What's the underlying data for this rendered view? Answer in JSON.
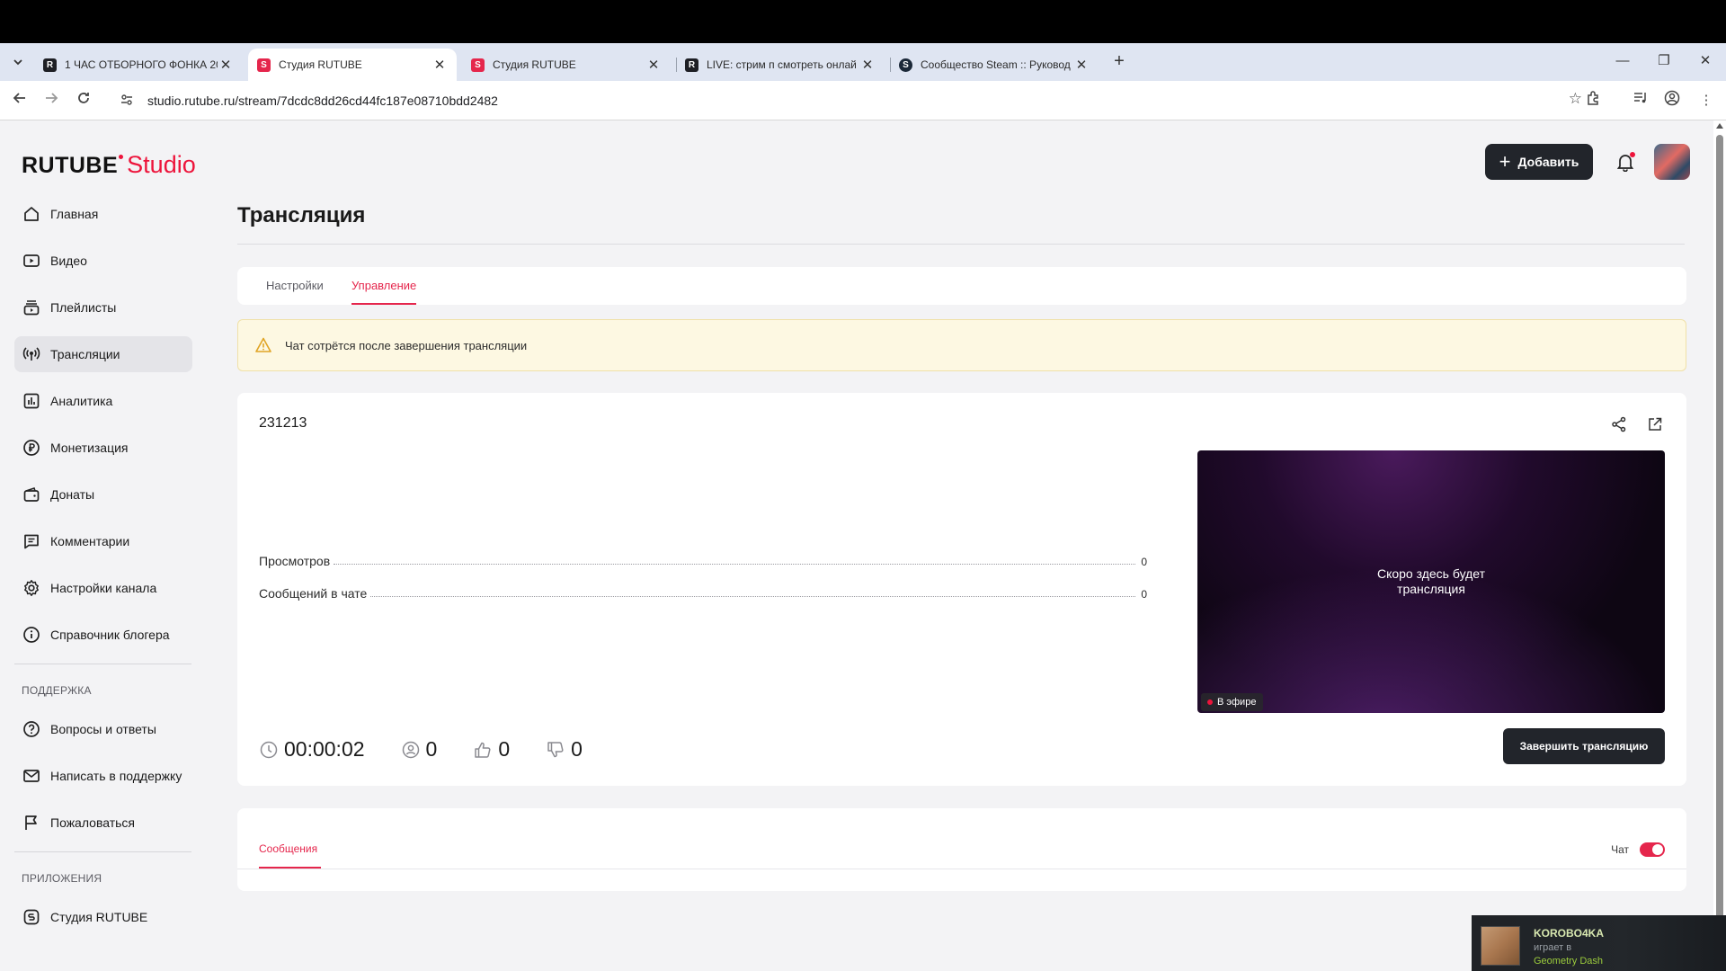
{
  "browser": {
    "tabs": [
      {
        "title": "1 ЧАС ОТБОРНОГО ФОНКА 20",
        "favicon": "rutube-logo",
        "color": "#1e1f25",
        "active": false
      },
      {
        "title": "Студия RUTUBE",
        "favicon": "rutube-studio-logo",
        "color": "#e5264c",
        "active": true
      },
      {
        "title": "Студия RUTUBE",
        "favicon": "rutube-studio-logo",
        "color": "#e5264c",
        "active": false
      },
      {
        "title": "LIVE: стрим п смотреть онлай",
        "favicon": "rutube-logo",
        "color": "#1e1f25",
        "active": false
      },
      {
        "title": "Сообщество Steam :: Руковод",
        "favicon": "steam-logo",
        "color": "#1b2838",
        "active": false
      }
    ],
    "url": "studio.rutube.ru/stream/7dcdc8dd26cd44fc187e08710bdd2482"
  },
  "logo": {
    "brand": "RUTUBE",
    "product": "Studio"
  },
  "header": {
    "add_label": "Добавить"
  },
  "sidebar": {
    "items": [
      {
        "label": "Главная",
        "icon": "home-icon"
      },
      {
        "label": "Видео",
        "icon": "video-icon"
      },
      {
        "label": "Плейлисты",
        "icon": "playlist-icon"
      },
      {
        "label": "Трансляции",
        "icon": "broadcast-icon",
        "active": true
      },
      {
        "label": "Аналитика",
        "icon": "analytics-icon"
      },
      {
        "label": "Монетизация",
        "icon": "ruble-icon"
      },
      {
        "label": "Донаты",
        "icon": "wallet-icon"
      },
      {
        "label": "Комментарии",
        "icon": "comment-icon"
      },
      {
        "label": "Настройки канала",
        "icon": "gear-icon"
      },
      {
        "label": "Справочник блогера",
        "icon": "info-icon"
      }
    ],
    "support_title": "ПОДДЕРЖКА",
    "support_items": [
      {
        "label": "Вопросы и ответы",
        "icon": "question-icon"
      },
      {
        "label": "Написать в поддержку",
        "icon": "mail-icon"
      },
      {
        "label": "Пожаловаться",
        "icon": "flag-icon"
      }
    ],
    "apps_title": "ПРИЛОЖЕНИЯ",
    "apps_items": [
      {
        "label": "Студия RUTUBE",
        "icon": "studio-app-icon"
      }
    ]
  },
  "page": {
    "title": "Трансляция",
    "tabs": [
      {
        "label": "Настройки",
        "active": false
      },
      {
        "label": "Управление",
        "active": true
      }
    ],
    "warning": "Чат сотрётся после завершения трансляции"
  },
  "stream": {
    "name": "231213",
    "stats": [
      {
        "label": "Просмотров",
        "value": "0"
      },
      {
        "label": "Сообщений в чате",
        "value": "0"
      }
    ],
    "player_text_line1": "Скоро здесь будет",
    "player_text_line2": "трансляция",
    "live_label": "В эфире",
    "duration": "00:00:02",
    "viewers": "0",
    "likes": "0",
    "dislikes": "0",
    "end_button": "Завершить трансляцию"
  },
  "messages": {
    "tab_label": "Сообщения",
    "chat_label": "Чат",
    "chat_enabled": true
  },
  "steam_toast": {
    "user": "KOROBO4KA",
    "status": "играет в",
    "game": "Geometry Dash"
  },
  "colors": {
    "accent": "#e5264c",
    "dark_button": "#22252b",
    "warning_bg": "#fdf8e2"
  }
}
